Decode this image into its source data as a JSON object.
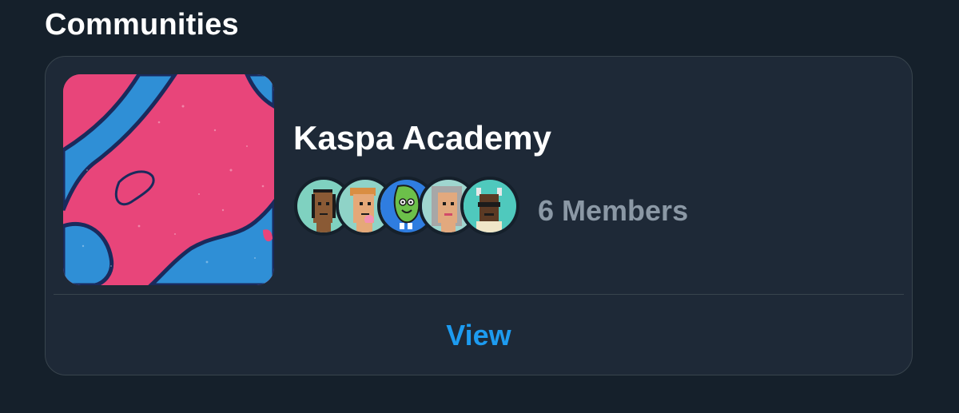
{
  "section": {
    "title": "Communities"
  },
  "community": {
    "name": "Kaspa Academy",
    "member_count_label": "6 Members",
    "view_label": "View",
    "banner_colors": {
      "pink": "#e8457a",
      "blue": "#2f8fd6",
      "outline": "#1a2a5c"
    },
    "member_avatars": [
      {
        "icon": "bald-pixel-punk-avatar",
        "bg": "#7fd1c0"
      },
      {
        "icon": "blonde-pixel-punk-avatar",
        "bg": "#8fd3c7"
      },
      {
        "icon": "green-leaf-character-avatar",
        "bg": "#2f7de0"
      },
      {
        "icon": "gray-hair-pixel-punk-avatar",
        "bg": "#9fd6cf"
      },
      {
        "icon": "horned-sunglasses-pixel-avatar",
        "bg": "#4fc9bd"
      }
    ]
  },
  "colors": {
    "background": "#15202b",
    "card": "#1e2937",
    "border": "#38444d",
    "accent": "#1d9bf0",
    "secondary_text": "#8b98a5"
  }
}
